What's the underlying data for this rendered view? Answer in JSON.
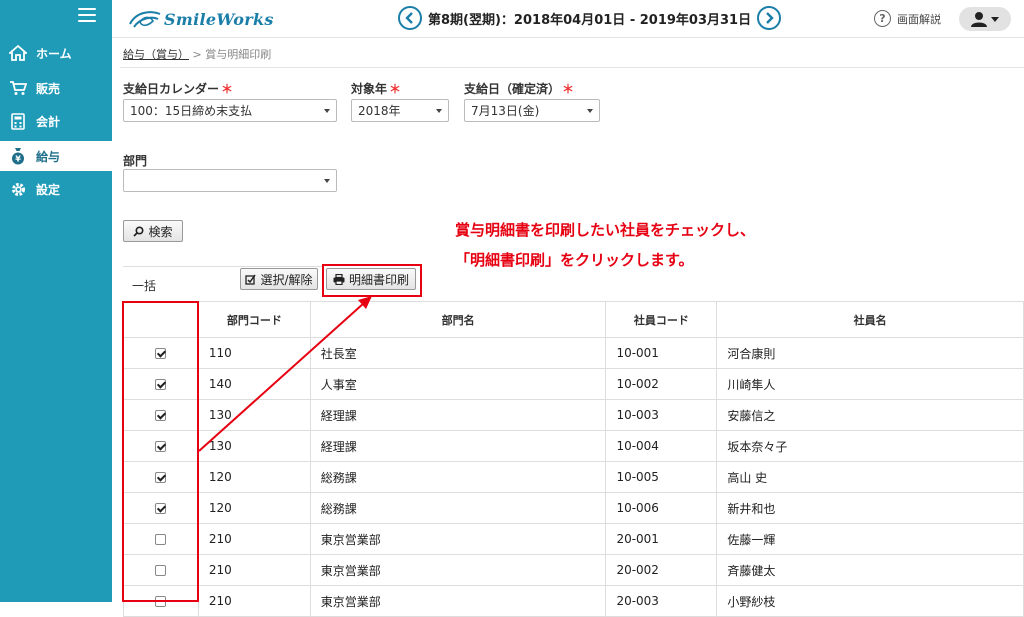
{
  "sidebar": {
    "items": [
      {
        "label": "ホーム",
        "icon": "home-icon"
      },
      {
        "label": "販売",
        "icon": "cart-icon"
      },
      {
        "label": "会計",
        "icon": "calculator-icon"
      },
      {
        "label": "給与",
        "icon": "money-bag-icon",
        "active": true
      },
      {
        "label": "設定",
        "icon": "gear-icon"
      }
    ]
  },
  "header": {
    "logo_text": "SmileWorks",
    "period": "第8期(翌期)：2018年04月01日 - 2019年03月31日",
    "help_label": "画面解説"
  },
  "breadcrumb": {
    "parent": "給与（賞与）",
    "separator": ">",
    "current": "賞与明細印刷"
  },
  "form": {
    "calendar_label": "支給日カレンダー",
    "calendar_value": "100：15日締め末支払",
    "year_label": "対象年",
    "year_value": "2018年",
    "paydate_label": "支給日（確定済）",
    "paydate_value": "7月13日(金)",
    "dept_label": "部門",
    "dept_value": "",
    "required_mark": "＊"
  },
  "buttons": {
    "search": "検索",
    "select_toggle": "選択/解除",
    "print": "明細書印刷",
    "bulk_label": "一括"
  },
  "table": {
    "headers": [
      "",
      "部門コード",
      "部門名",
      "社員コード",
      "社員名"
    ],
    "rows": [
      {
        "checked": true,
        "dept_code": "110",
        "dept_name": "社長室",
        "emp_code": "10-001",
        "emp_name": "河合康則"
      },
      {
        "checked": true,
        "dept_code": "140",
        "dept_name": "人事室",
        "emp_code": "10-002",
        "emp_name": "川崎隼人"
      },
      {
        "checked": true,
        "dept_code": "130",
        "dept_name": "経理課",
        "emp_code": "10-003",
        "emp_name": "安藤信之"
      },
      {
        "checked": true,
        "dept_code": "130",
        "dept_name": "経理課",
        "emp_code": "10-004",
        "emp_name": "坂本奈々子"
      },
      {
        "checked": true,
        "dept_code": "120",
        "dept_name": "総務課",
        "emp_code": "10-005",
        "emp_name": "高山 史"
      },
      {
        "checked": true,
        "dept_code": "120",
        "dept_name": "総務課",
        "emp_code": "10-006",
        "emp_name": "新井和也"
      },
      {
        "checked": false,
        "dept_code": "210",
        "dept_name": "東京営業部",
        "emp_code": "20-001",
        "emp_name": "佐藤一輝"
      },
      {
        "checked": false,
        "dept_code": "210",
        "dept_name": "東京営業部",
        "emp_code": "20-002",
        "emp_name": "斉藤健太"
      },
      {
        "checked": false,
        "dept_code": "210",
        "dept_name": "東京営業部",
        "emp_code": "20-003",
        "emp_name": "小野紗枝"
      }
    ]
  },
  "annotation": {
    "line1": "賞与明細書を印刷したい社員をチェックし、",
    "line2": "「明細書印刷」をクリックします。",
    "color": "#e60012"
  },
  "colors": {
    "sidebar": "#1f9bb7",
    "brand": "#1a7ea8"
  }
}
